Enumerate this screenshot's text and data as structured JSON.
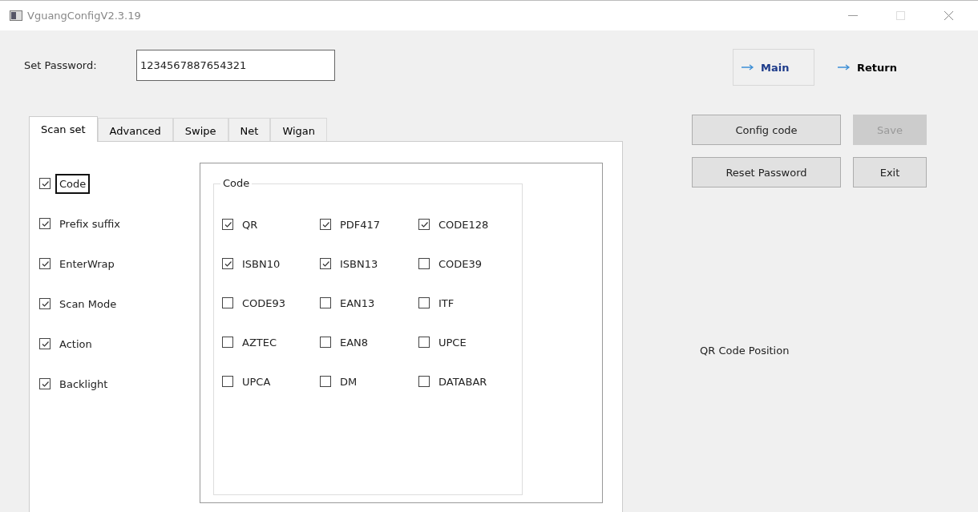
{
  "window": {
    "title": "VguangConfigV2.3.19"
  },
  "password": {
    "label": "Set Password:",
    "value": "1234567887654321"
  },
  "nav_buttons": [
    {
      "label": "Main",
      "framed": true
    },
    {
      "label": "Return",
      "framed": false
    }
  ],
  "tabs": [
    {
      "label": "Scan set",
      "selected": true
    },
    {
      "label": "Advanced",
      "selected": false
    },
    {
      "label": "Swipe",
      "selected": false
    },
    {
      "label": "Net",
      "selected": false
    },
    {
      "label": "Wigan",
      "selected": false
    }
  ],
  "sections": [
    {
      "label": "Code",
      "checked": true,
      "focused": true
    },
    {
      "label": "Prefix suffix",
      "checked": true,
      "focused": false
    },
    {
      "label": "EnterWrap",
      "checked": true,
      "focused": false
    },
    {
      "label": "Scan Mode",
      "checked": true,
      "focused": false
    },
    {
      "label": "Action",
      "checked": true,
      "focused": false
    },
    {
      "label": "Backlight",
      "checked": true,
      "focused": false
    }
  ],
  "code_group": {
    "title": "Code",
    "options": [
      {
        "label": "QR",
        "checked": true
      },
      {
        "label": "PDF417",
        "checked": true
      },
      {
        "label": "CODE128",
        "checked": true
      },
      {
        "label": "ISBN10",
        "checked": true
      },
      {
        "label": "ISBN13",
        "checked": true
      },
      {
        "label": "CODE39",
        "checked": false
      },
      {
        "label": "CODE93",
        "checked": false
      },
      {
        "label": "EAN13",
        "checked": false
      },
      {
        "label": "ITF",
        "checked": false
      },
      {
        "label": "AZTEC",
        "checked": false
      },
      {
        "label": "EAN8",
        "checked": false
      },
      {
        "label": "UPCE",
        "checked": false
      },
      {
        "label": "UPCA",
        "checked": false
      },
      {
        "label": "DM",
        "checked": false
      },
      {
        "label": "DATABAR",
        "checked": false
      }
    ]
  },
  "action_buttons": [
    {
      "label": "Config code",
      "disabled": false
    },
    {
      "label": "Save",
      "disabled": true
    },
    {
      "label": "Reset Password",
      "disabled": false
    },
    {
      "label": "Exit",
      "disabled": false
    }
  ],
  "qr_position_label": "QR Code Position"
}
